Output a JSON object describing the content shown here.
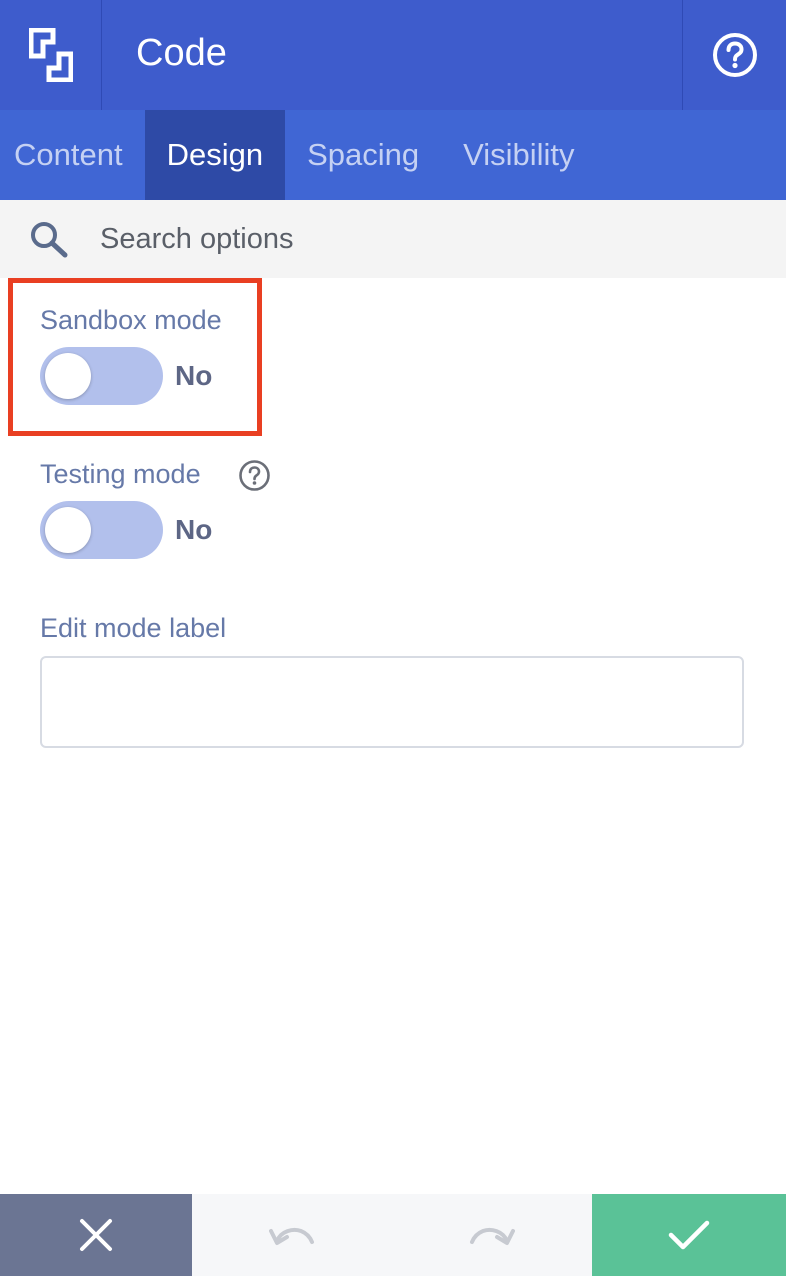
{
  "header": {
    "title": "Code",
    "logo_icon": "builder-logo-icon",
    "help_icon": "question-circle-icon"
  },
  "tabs": [
    {
      "label": "Content",
      "active": false
    },
    {
      "label": "Design",
      "active": true
    },
    {
      "label": "Spacing",
      "active": false
    },
    {
      "label": "Visibility",
      "active": false
    }
  ],
  "search": {
    "placeholder": "Search options",
    "value": "",
    "icon": "search-icon"
  },
  "options": {
    "sandbox": {
      "label": "Sandbox mode",
      "state": "No"
    },
    "testing": {
      "label": "Testing mode",
      "state": "No"
    },
    "edit_label": {
      "label": "Edit mode label",
      "value": ""
    }
  },
  "footer": {
    "cancel_icon": "close-icon",
    "undo_icon": "undo-icon",
    "redo_icon": "redo-icon",
    "save_icon": "check-icon"
  },
  "colors": {
    "header": "#3e5ccc",
    "tabs": "#4066d4",
    "active_tab": "#2e4aa6",
    "highlight": "#e93f22",
    "save": "#5ac297",
    "cancel": "#6b7593"
  }
}
